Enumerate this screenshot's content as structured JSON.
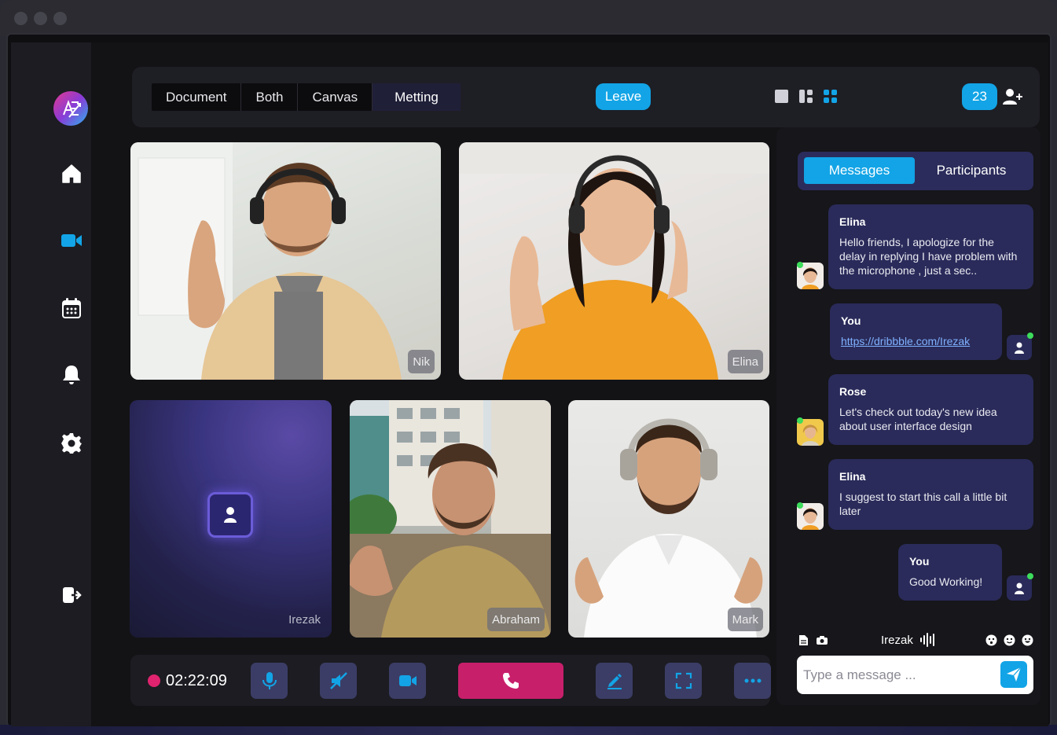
{
  "window": {
    "controls": [
      "close",
      "minimize",
      "maximize"
    ]
  },
  "brand": {
    "logo_icon": "ae-logo-icon",
    "colors": [
      "#e33a8f",
      "#8a3bd6",
      "#2bb3f0"
    ]
  },
  "sidebar": {
    "items": [
      {
        "icon": "home-icon",
        "active": false
      },
      {
        "icon": "video-camera-icon",
        "active": true
      },
      {
        "icon": "calendar-icon",
        "active": false
      },
      {
        "icon": "bell-icon",
        "active": false
      },
      {
        "icon": "gear-icon",
        "active": false
      },
      {
        "icon": "logout-icon",
        "active": false
      }
    ]
  },
  "topbar": {
    "tabs": [
      {
        "label": "Document"
      },
      {
        "label": "Both"
      },
      {
        "label": "Canvas"
      },
      {
        "label": "Metting",
        "active": true
      }
    ],
    "leave_label": "Leave",
    "layout_icons": [
      "single-view-icon",
      "split-view-icon",
      "grid-view-icon"
    ],
    "participants_count": "23",
    "accent": "#12a4e6"
  },
  "video": {
    "tiles": [
      {
        "name": "Nik",
        "camera": "on"
      },
      {
        "name": "Elina",
        "camera": "on"
      },
      {
        "name": "Irezak",
        "camera": "off"
      },
      {
        "name": "Abraham",
        "camera": "on"
      },
      {
        "name": "Mark",
        "camera": "on"
      }
    ]
  },
  "controls": {
    "timer": "02:22:09",
    "recording_color": "#e0236e",
    "buttons": [
      "microphone-icon",
      "speaker-muted-icon",
      "camera-icon",
      "phone-icon",
      "draw-icon",
      "fullscreen-icon",
      "more-icon"
    ],
    "end_call_color": "#c81f6b"
  },
  "chat": {
    "tabs": [
      {
        "label": "Messages",
        "active": true
      },
      {
        "label": "Participants",
        "active": false
      }
    ],
    "messages": [
      {
        "sender": "Elina",
        "text": "Hello friends, I apologize for the delay in replying I have problem with the microphone , just a sec..",
        "mine": false
      },
      {
        "sender": "You",
        "text": "https://dribbble.com/Irezak",
        "mine": true,
        "is_link": true
      },
      {
        "sender": "Rose",
        "text": "Let's check out today's new idea about user interface design",
        "mine": false
      },
      {
        "sender": "Elina",
        "text": "I suggest to start this call a little bit later",
        "mine": false
      },
      {
        "sender": "You",
        "text": "Good Working!",
        "mine": true
      }
    ],
    "composer": {
      "current_user": "Irezak",
      "placeholder": "Type a message ...",
      "value": "",
      "left_icons": [
        "file-icon",
        "camera-icon"
      ],
      "right_icons": [
        "emoji-surprised-icon",
        "emoji-smile-icon",
        "emoji-happy-icon"
      ]
    }
  }
}
